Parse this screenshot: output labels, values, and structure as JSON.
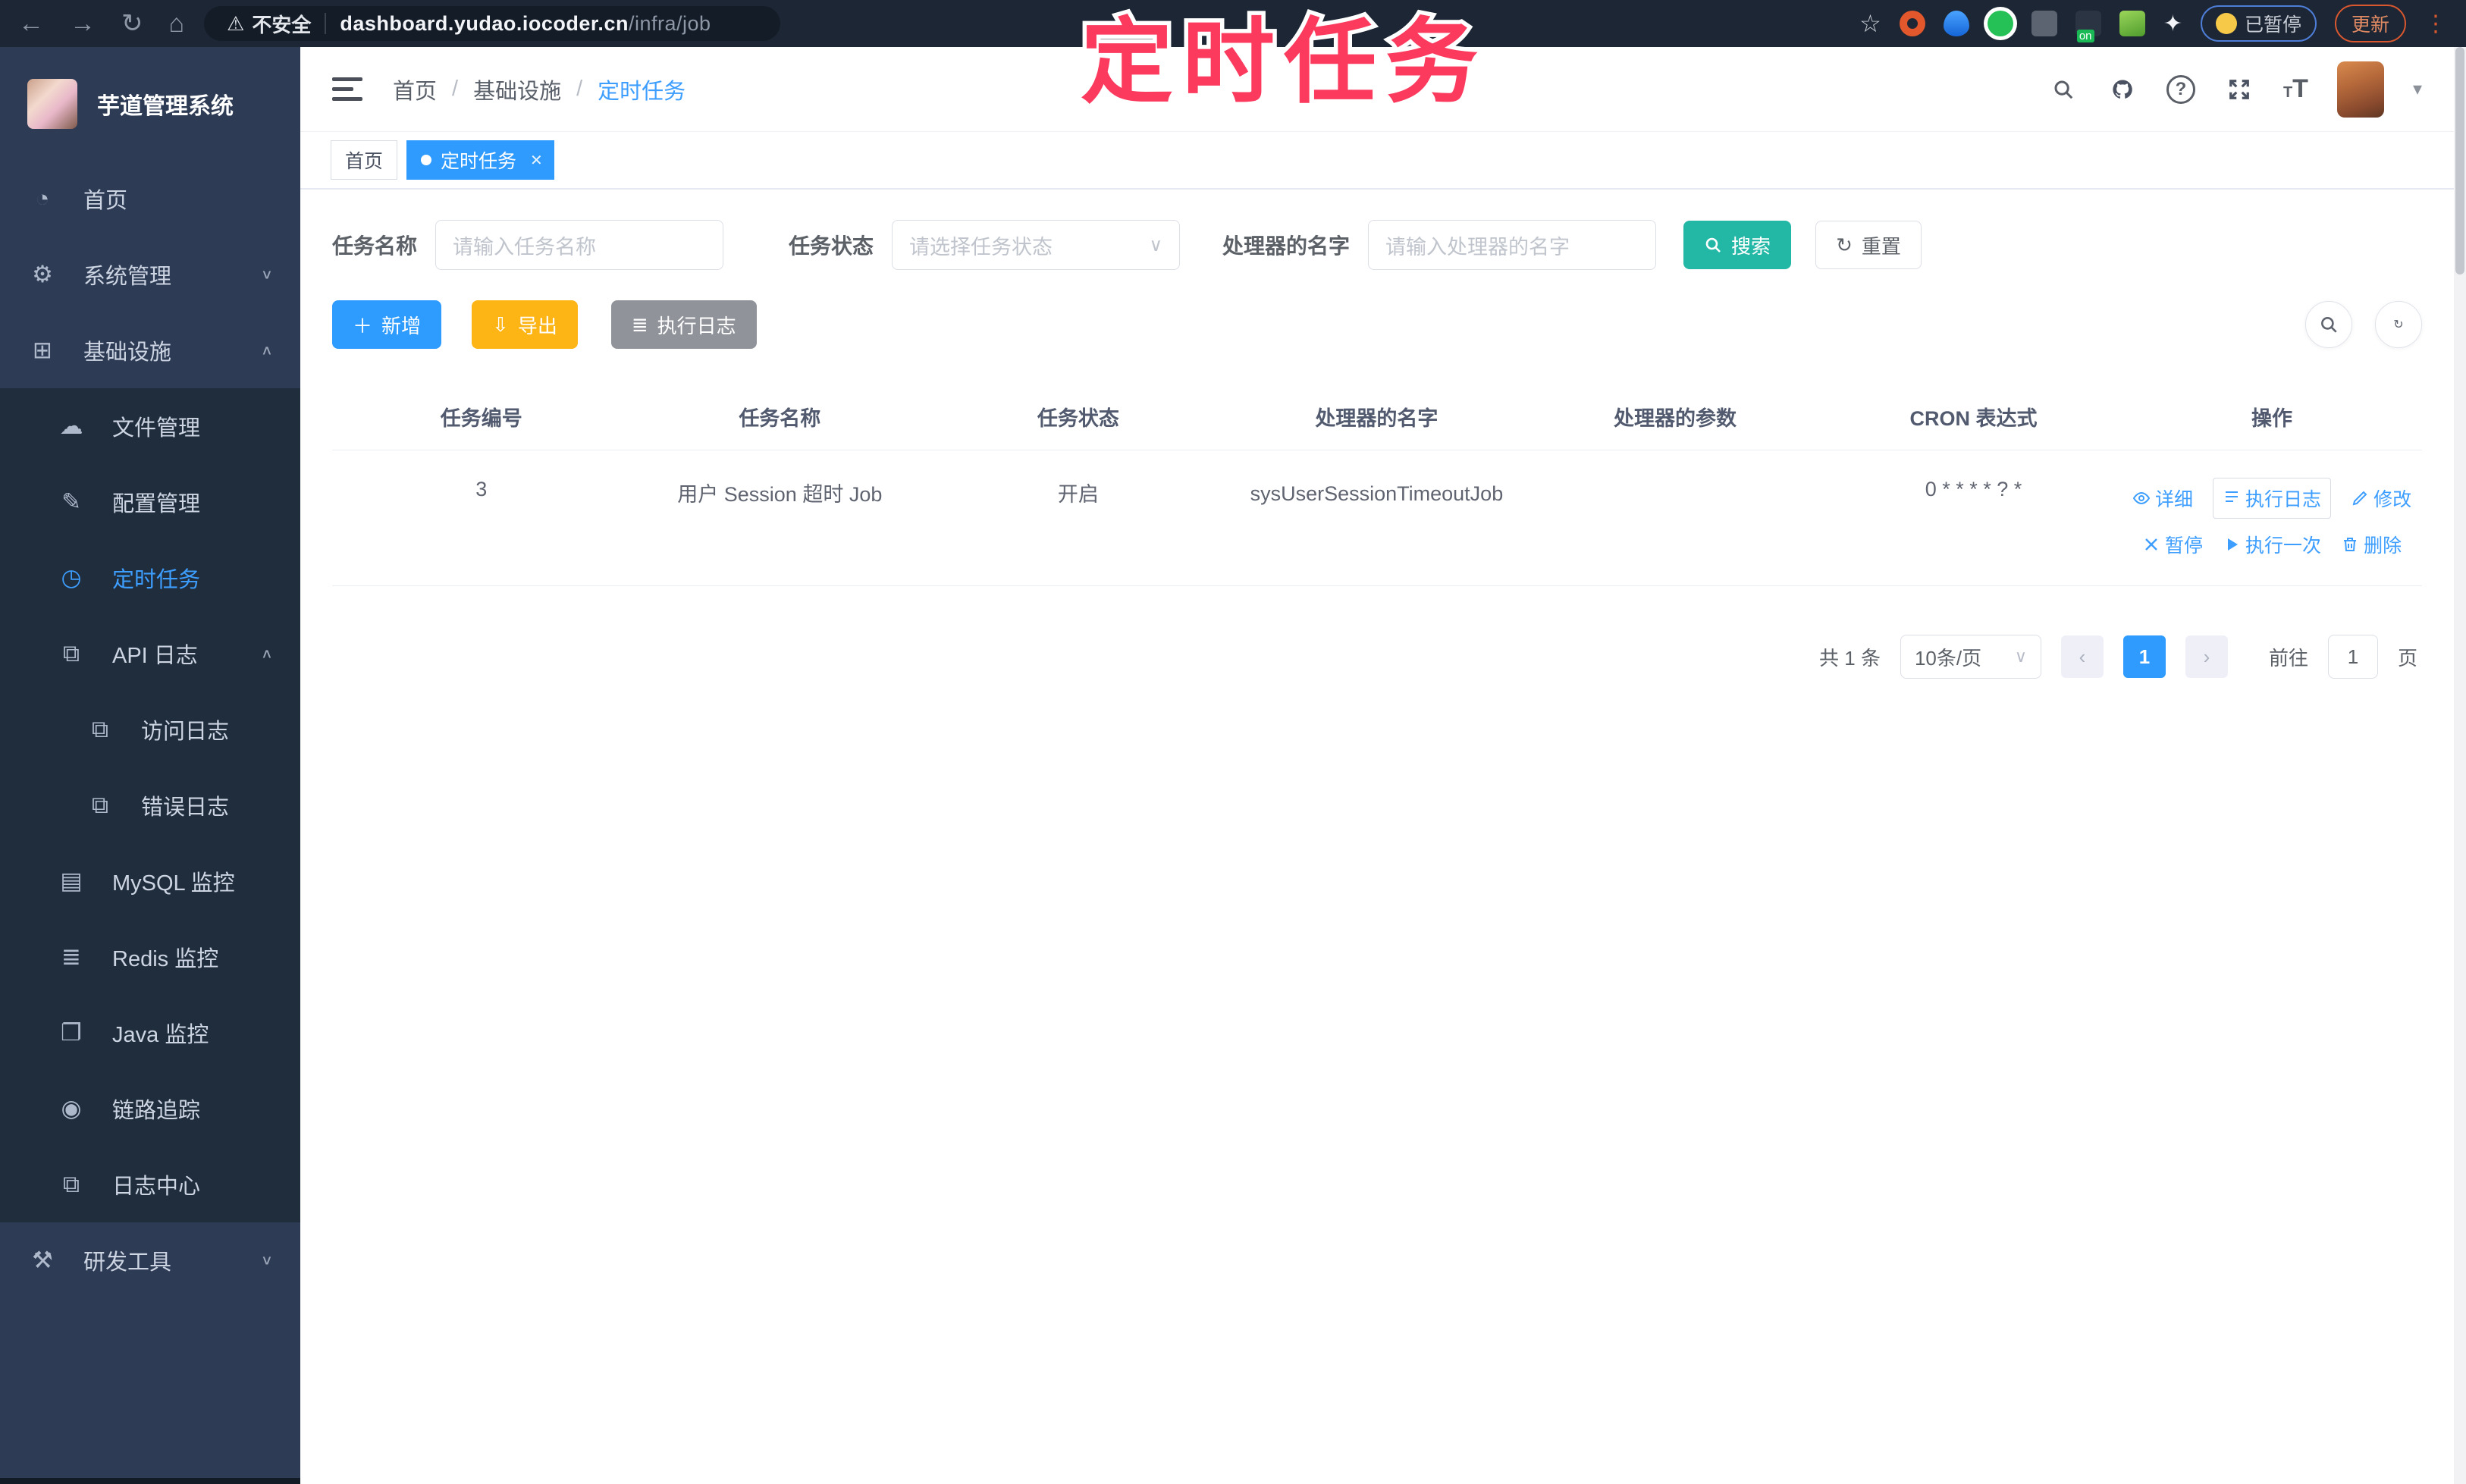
{
  "browser": {
    "security_warning": "不安全",
    "url_host": "dashboard.yudao.iocoder.cn",
    "url_path": "/infra/job",
    "paused_badge": "已暂停",
    "update_button": "更新"
  },
  "annotation": {
    "text": "定时任务",
    "color": "#fb3a5e"
  },
  "sidebar": {
    "title": "芋道管理系统",
    "items": [
      {
        "label": "首页"
      },
      {
        "label": "系统管理"
      },
      {
        "label": "基础设施"
      },
      {
        "label": "文件管理"
      },
      {
        "label": "配置管理"
      },
      {
        "label": "定时任务"
      },
      {
        "label": "API 日志"
      },
      {
        "label": "访问日志"
      },
      {
        "label": "错误日志"
      },
      {
        "label": "MySQL 监控"
      },
      {
        "label": "Redis 监控"
      },
      {
        "label": "Java 监控"
      },
      {
        "label": "链路追踪"
      },
      {
        "label": "日志中心"
      },
      {
        "label": "研发工具"
      }
    ]
  },
  "header": {
    "breadcrumb": [
      "首页",
      "基础设施",
      "定时任务"
    ]
  },
  "tabs": [
    {
      "label": "首页"
    },
    {
      "label": "定时任务"
    }
  ],
  "filters": {
    "name_label": "任务名称",
    "name_placeholder": "请输入任务名称",
    "status_label": "任务状态",
    "status_placeholder": "请选择任务状态",
    "handler_label": "处理器的名字",
    "handler_placeholder": "请输入处理器的名字",
    "search": "搜索",
    "reset": "重置"
  },
  "toolbar": {
    "add": "新增",
    "export": "导出",
    "exec_log": "执行日志"
  },
  "table": {
    "columns": [
      "任务编号",
      "任务名称",
      "任务状态",
      "处理器的名字",
      "处理器的参数",
      "CRON 表达式",
      "操作"
    ],
    "row": {
      "id": "3",
      "name": "用户 Session 超时 Job",
      "status": "开启",
      "handler": "sysUserSessionTimeoutJob",
      "params": "",
      "cron": "0 * * * * ? *"
    },
    "ops": [
      {
        "label": "详细"
      },
      {
        "label": "执行日志"
      },
      {
        "label": "修改"
      },
      {
        "label": "暂停"
      },
      {
        "label": "执行一次"
      },
      {
        "label": "删除"
      }
    ]
  },
  "pagination": {
    "total": "共 1 条",
    "page_size": "10条/页",
    "page": "1",
    "goto_label": "前往",
    "goto_value": "1",
    "goto_suffix": "页"
  },
  "colors": {
    "accent_blue": "#2f9bff",
    "teal": "#23b7a5",
    "amber": "#fdb415",
    "gray": "#909399"
  }
}
